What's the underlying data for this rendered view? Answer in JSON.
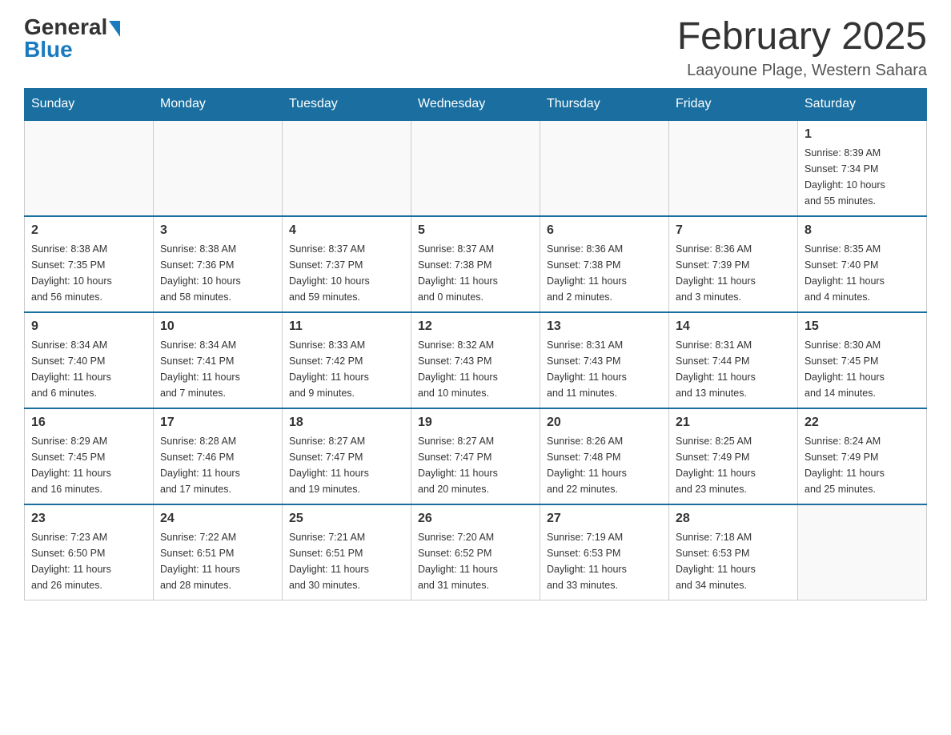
{
  "header": {
    "logo_general": "General",
    "logo_blue": "Blue",
    "title": "February 2025",
    "subtitle": "Laayoune Plage, Western Sahara"
  },
  "days_of_week": [
    "Sunday",
    "Monday",
    "Tuesday",
    "Wednesday",
    "Thursday",
    "Friday",
    "Saturday"
  ],
  "weeks": [
    [
      {
        "day": "",
        "info": ""
      },
      {
        "day": "",
        "info": ""
      },
      {
        "day": "",
        "info": ""
      },
      {
        "day": "",
        "info": ""
      },
      {
        "day": "",
        "info": ""
      },
      {
        "day": "",
        "info": ""
      },
      {
        "day": "1",
        "info": "Sunrise: 8:39 AM\nSunset: 7:34 PM\nDaylight: 10 hours\nand 55 minutes."
      }
    ],
    [
      {
        "day": "2",
        "info": "Sunrise: 8:38 AM\nSunset: 7:35 PM\nDaylight: 10 hours\nand 56 minutes."
      },
      {
        "day": "3",
        "info": "Sunrise: 8:38 AM\nSunset: 7:36 PM\nDaylight: 10 hours\nand 58 minutes."
      },
      {
        "day": "4",
        "info": "Sunrise: 8:37 AM\nSunset: 7:37 PM\nDaylight: 10 hours\nand 59 minutes."
      },
      {
        "day": "5",
        "info": "Sunrise: 8:37 AM\nSunset: 7:38 PM\nDaylight: 11 hours\nand 0 minutes."
      },
      {
        "day": "6",
        "info": "Sunrise: 8:36 AM\nSunset: 7:38 PM\nDaylight: 11 hours\nand 2 minutes."
      },
      {
        "day": "7",
        "info": "Sunrise: 8:36 AM\nSunset: 7:39 PM\nDaylight: 11 hours\nand 3 minutes."
      },
      {
        "day": "8",
        "info": "Sunrise: 8:35 AM\nSunset: 7:40 PM\nDaylight: 11 hours\nand 4 minutes."
      }
    ],
    [
      {
        "day": "9",
        "info": "Sunrise: 8:34 AM\nSunset: 7:40 PM\nDaylight: 11 hours\nand 6 minutes."
      },
      {
        "day": "10",
        "info": "Sunrise: 8:34 AM\nSunset: 7:41 PM\nDaylight: 11 hours\nand 7 minutes."
      },
      {
        "day": "11",
        "info": "Sunrise: 8:33 AM\nSunset: 7:42 PM\nDaylight: 11 hours\nand 9 minutes."
      },
      {
        "day": "12",
        "info": "Sunrise: 8:32 AM\nSunset: 7:43 PM\nDaylight: 11 hours\nand 10 minutes."
      },
      {
        "day": "13",
        "info": "Sunrise: 8:31 AM\nSunset: 7:43 PM\nDaylight: 11 hours\nand 11 minutes."
      },
      {
        "day": "14",
        "info": "Sunrise: 8:31 AM\nSunset: 7:44 PM\nDaylight: 11 hours\nand 13 minutes."
      },
      {
        "day": "15",
        "info": "Sunrise: 8:30 AM\nSunset: 7:45 PM\nDaylight: 11 hours\nand 14 minutes."
      }
    ],
    [
      {
        "day": "16",
        "info": "Sunrise: 8:29 AM\nSunset: 7:45 PM\nDaylight: 11 hours\nand 16 minutes."
      },
      {
        "day": "17",
        "info": "Sunrise: 8:28 AM\nSunset: 7:46 PM\nDaylight: 11 hours\nand 17 minutes."
      },
      {
        "day": "18",
        "info": "Sunrise: 8:27 AM\nSunset: 7:47 PM\nDaylight: 11 hours\nand 19 minutes."
      },
      {
        "day": "19",
        "info": "Sunrise: 8:27 AM\nSunset: 7:47 PM\nDaylight: 11 hours\nand 20 minutes."
      },
      {
        "day": "20",
        "info": "Sunrise: 8:26 AM\nSunset: 7:48 PM\nDaylight: 11 hours\nand 22 minutes."
      },
      {
        "day": "21",
        "info": "Sunrise: 8:25 AM\nSunset: 7:49 PM\nDaylight: 11 hours\nand 23 minutes."
      },
      {
        "day": "22",
        "info": "Sunrise: 8:24 AM\nSunset: 7:49 PM\nDaylight: 11 hours\nand 25 minutes."
      }
    ],
    [
      {
        "day": "23",
        "info": "Sunrise: 7:23 AM\nSunset: 6:50 PM\nDaylight: 11 hours\nand 26 minutes."
      },
      {
        "day": "24",
        "info": "Sunrise: 7:22 AM\nSunset: 6:51 PM\nDaylight: 11 hours\nand 28 minutes."
      },
      {
        "day": "25",
        "info": "Sunrise: 7:21 AM\nSunset: 6:51 PM\nDaylight: 11 hours\nand 30 minutes."
      },
      {
        "day": "26",
        "info": "Sunrise: 7:20 AM\nSunset: 6:52 PM\nDaylight: 11 hours\nand 31 minutes."
      },
      {
        "day": "27",
        "info": "Sunrise: 7:19 AM\nSunset: 6:53 PM\nDaylight: 11 hours\nand 33 minutes."
      },
      {
        "day": "28",
        "info": "Sunrise: 7:18 AM\nSunset: 6:53 PM\nDaylight: 11 hours\nand 34 minutes."
      },
      {
        "day": "",
        "info": ""
      }
    ]
  ]
}
